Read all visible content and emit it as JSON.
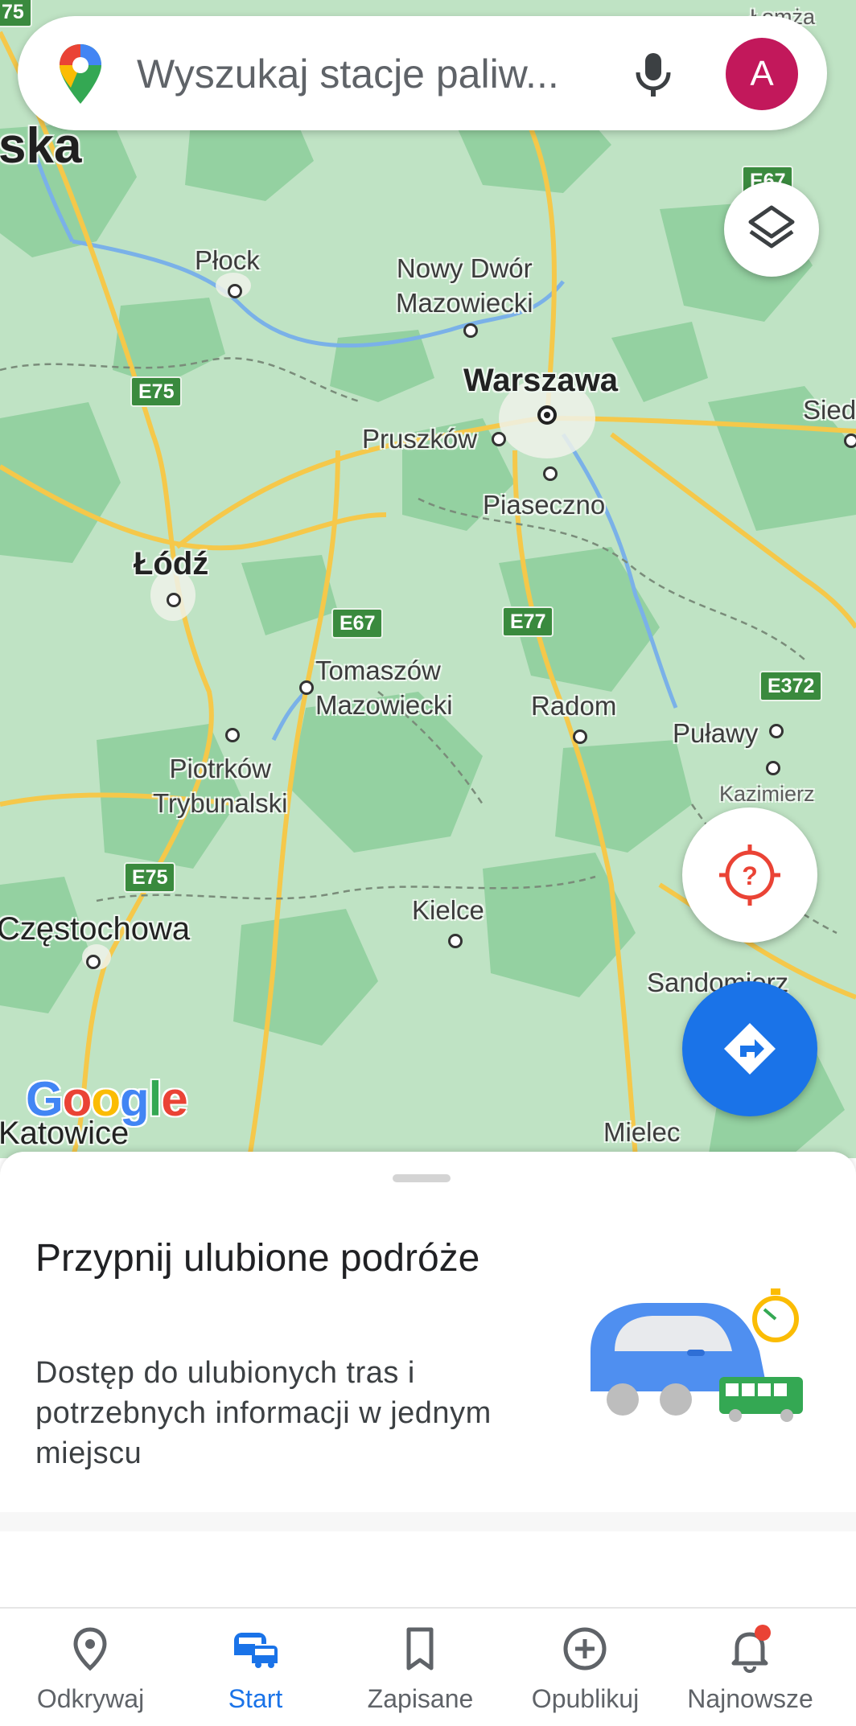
{
  "search": {
    "placeholder": "Wyszukaj stacje paliw...",
    "avatar_letter": "A"
  },
  "map": {
    "brand": "Google",
    "cities": [
      {
        "name": "Płock"
      },
      {
        "name": "Nowy Dwór\nMazowiecki"
      },
      {
        "name": "Warszawa"
      },
      {
        "name": "Pruszków"
      },
      {
        "name": "Piaseczno"
      },
      {
        "name": "Łódź"
      },
      {
        "name": "Tomaszów\nMazowiecki"
      },
      {
        "name": "Radom"
      },
      {
        "name": "Puławy"
      },
      {
        "name": "Piotrków\nTrybunalski"
      },
      {
        "name": "Kazimierz"
      },
      {
        "name": "Kielce"
      },
      {
        "name": "Częstochowa"
      },
      {
        "name": "Sandomierz"
      },
      {
        "name": "Katowice"
      },
      {
        "name": "Mielec"
      },
      {
        "name": "Łomża"
      },
      {
        "name": "Sied"
      },
      {
        "name": "ska"
      }
    ],
    "roads": [
      "E75",
      "E75",
      "E67",
      "E77",
      "E372",
      "E75",
      "E67",
      "75"
    ]
  },
  "card": {
    "title": "Przypnij ulubione podróże",
    "description": "Dostęp do ulubionych tras i potrzebnych informacji w jednym miejscu"
  },
  "nav": {
    "items": [
      {
        "label": "Odkrywaj",
        "icon": "pin-outline-icon"
      },
      {
        "label": "Start",
        "icon": "commute-icon",
        "active": true
      },
      {
        "label": "Zapisane",
        "icon": "bookmark-icon"
      },
      {
        "label": "Opublikuj",
        "icon": "add-circle-icon"
      },
      {
        "label": "Najnowsze",
        "icon": "bell-icon",
        "badge": true
      }
    ]
  },
  "colors": {
    "accent": "#1a73e8",
    "avatar": "#c2185b",
    "map_base": "#bfe3c4",
    "badge": "#ea4335"
  }
}
